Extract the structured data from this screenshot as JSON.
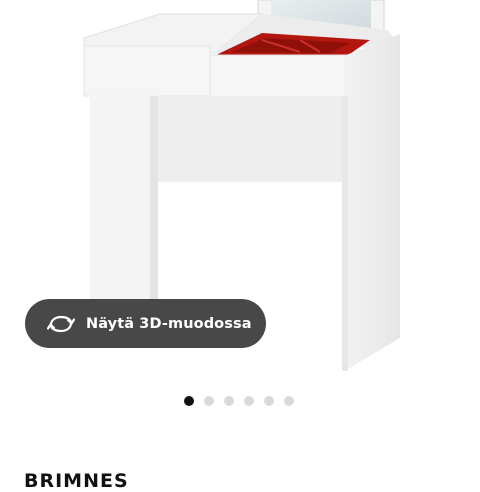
{
  "product": {
    "name": "BRIMNES"
  },
  "gallery": {
    "view_3d_label": "Näytä 3D-muodossa",
    "dot_count": 6,
    "active_index": 0
  },
  "colors": {
    "pill_bg": "#383838",
    "dot_active": "#111111",
    "dot_inactive": "#d9d9d9",
    "compartment_red": "#b3160f"
  }
}
